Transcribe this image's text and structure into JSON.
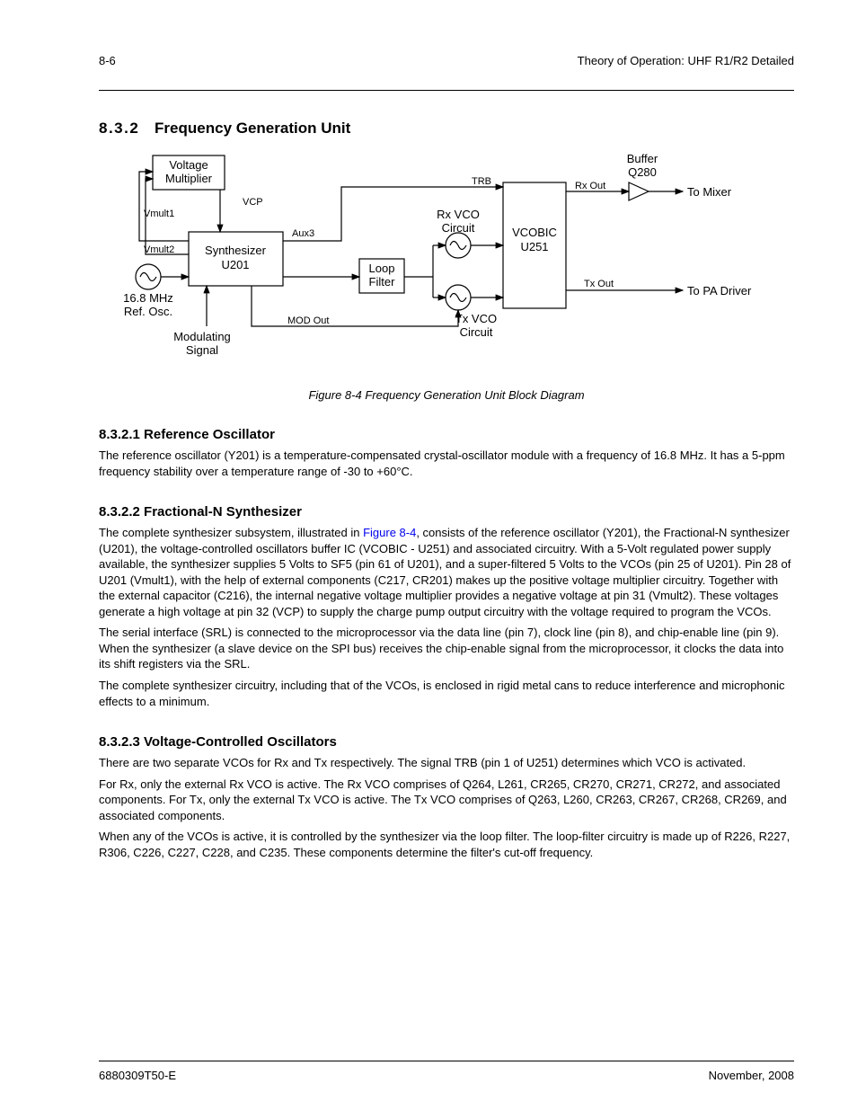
{
  "header": {
    "page_num": "8-6",
    "title": "Theory of Operation: UHF R1/R2 Detailed"
  },
  "sec1": {
    "heading_num": "8.3.2",
    "heading_text": "Frequency Generation Unit"
  },
  "figure": {
    "blocks": {
      "voltage_multiplier": "Voltage\nMultiplier",
      "synthesizer": "Synthesizer\nU201",
      "loop_filter": "Loop\nFilter",
      "rx_vco": "Rx VCO\nCircuit",
      "tx_vco": "Tx VCO\nCircuit",
      "vcobic": "VCOBIC\nU251",
      "buffer": "Buffer\nQ280"
    },
    "signals": {
      "vmult1": "Vmult1",
      "vmult2": "Vmult2",
      "vcp": "VCP",
      "aux3": "Aux3",
      "ref_osc": "16.8 MHz\nRef. Osc.",
      "modulating": "Modulating\nSignal",
      "mod_out": "MOD Out",
      "trb": "TRB",
      "rx_out": "Rx Out",
      "tx_out": "Tx Out",
      "to_mixer": "To Mixer",
      "to_pa": "To PA Driver"
    },
    "caption": "Figure 8-4 Frequency Generation Unit Block Diagram"
  },
  "sec1_1": {
    "heading": "8.3.2.1 Reference Oscillator",
    "para": "The reference oscillator (Y201) is a temperature-compensated crystal-oscillator module with a frequency of 16.8 MHz. It has a 5-ppm frequency stability over a temperature range of -30 to +60°C."
  },
  "sec1_2": {
    "heading": "8.3.2.2 Fractional-N Synthesizer",
    "para1_part1": "The complete synthesizer subsystem, illustrated in ",
    "link": "Figure 8-4",
    "para1_part2": ", consists of the reference oscillator (Y201), the Fractional-N synthesizer (U201), the voltage-controlled oscillators buffer IC (VCOBIC - U251) and associated circuitry. With a 5-Volt regulated power supply available, the synthesizer supplies 5 Volts to SF5 (pin 61 of U201), and a super-filtered 5 Volts to the VCOs (pin 25 of U201). Pin 28 of U201 (Vmult1), with the help of external components (C217, CR201) makes up the positive voltage multiplier circuitry. Together with the external capacitor (C216), the internal negative voltage multiplier provides a negative voltage at pin 31 (Vmult2). These voltages generate a high voltage at pin 32 (VCP) to supply the charge pump output circuitry with the voltage required to program the VCOs.",
    "para2": "The serial interface (SRL) is connected to the microprocessor via the data line (pin 7), clock line (pin 8), and chip-enable line (pin 9). When the synthesizer (a slave device on the SPI bus) receives the chip-enable signal from the microprocessor, it clocks the data into its shift registers via the SRL.",
    "para3": "The complete synthesizer circuitry, including that of the VCOs, is enclosed in rigid metal cans to reduce interference and microphonic effects to a minimum."
  },
  "sec1_3": {
    "heading": "8.3.2.3 Voltage-Controlled Oscillators",
    "para1": "There are two separate VCOs for Rx and Tx respectively. The signal TRB (pin 1 of U251) determines which VCO is activated.",
    "para2": "For Rx, only the external Rx VCO is active. The Rx VCO comprises of Q264, L261, CR265, CR270, CR271, CR272, and associated components. For Tx, only the external Tx VCO is active. The Tx VCO comprises of Q263, L260, CR263, CR267, CR268, CR269, and associated components.",
    "para3": "When any of the VCOs is active, it is controlled by the synthesizer via the loop filter. The loop-filter circuitry is made up of R226, R227, R306, C226, C227, C228, and C235. These components determine the filter's cut-off frequency."
  },
  "footer": {
    "left": "6880309T50-E",
    "right": "November, 2008"
  }
}
